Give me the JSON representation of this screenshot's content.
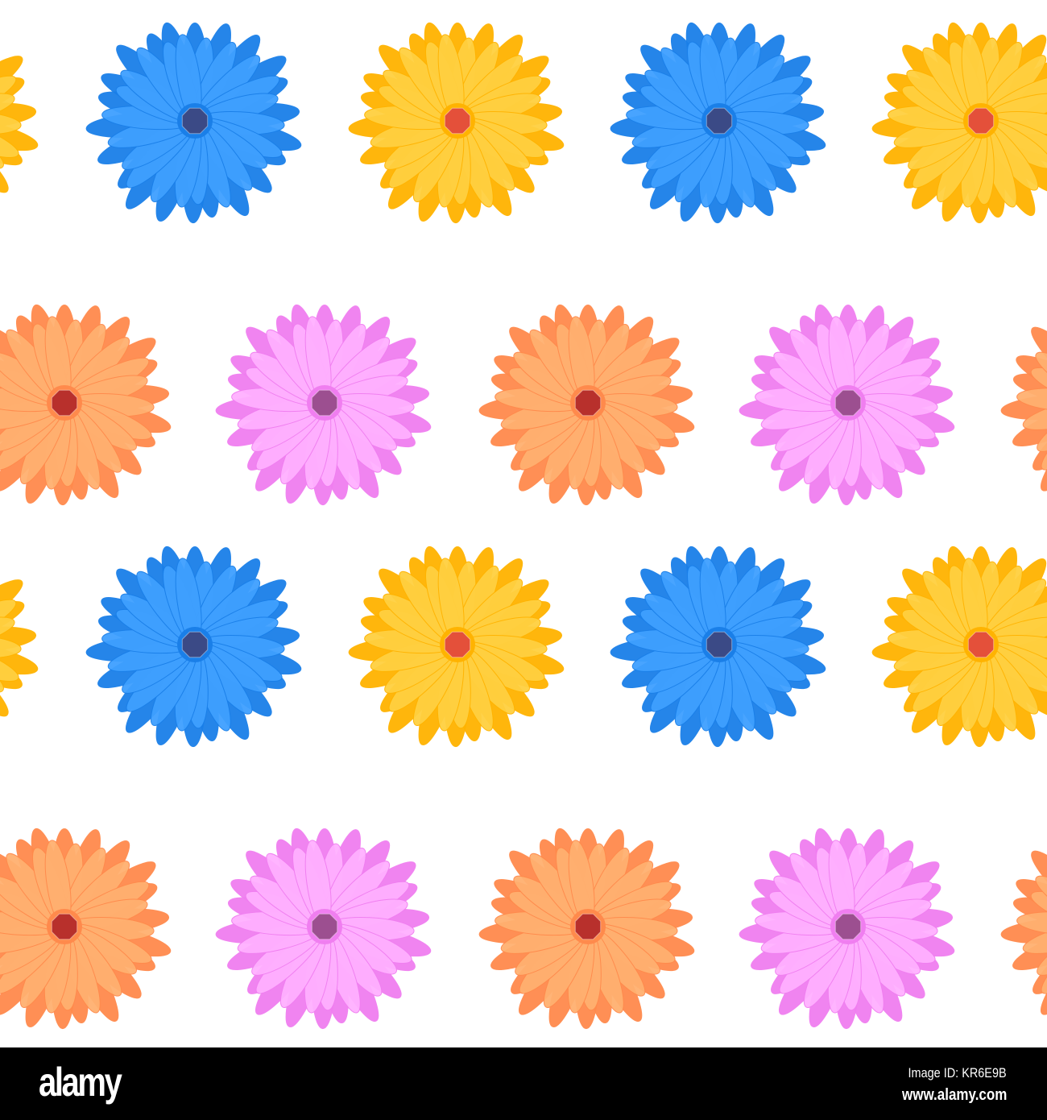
{
  "pattern": {
    "palette": {
      "blue": {
        "petal": "#1a7fe8",
        "petal_light": "#3fa0ff",
        "center": "#3b4a86"
      },
      "yellow": {
        "petal": "#ffb300",
        "petal_light": "#ffd040",
        "center": "#e4503a"
      },
      "salmon": {
        "petal": "#ff8a4c",
        "petal_light": "#ffb070",
        "center": "#b8302c"
      },
      "pink": {
        "petal": "#f07ef0",
        "petal_light": "#ffb0ff",
        "center": "#9c4f90"
      }
    },
    "rows": [
      [
        "yellow",
        "blue",
        "yellow",
        "blue",
        "yellow"
      ],
      [
        "salmon",
        "pink",
        "salmon",
        "pink",
        "salmon"
      ],
      [
        "yellow",
        "blue",
        "yellow",
        "blue",
        "yellow"
      ],
      [
        "salmon",
        "pink",
        "salmon",
        "pink",
        "salmon"
      ]
    ]
  },
  "footer": {
    "logo": "alamy",
    "image_id": "Image ID: KR6E9B",
    "url": "www.alamy.com"
  }
}
